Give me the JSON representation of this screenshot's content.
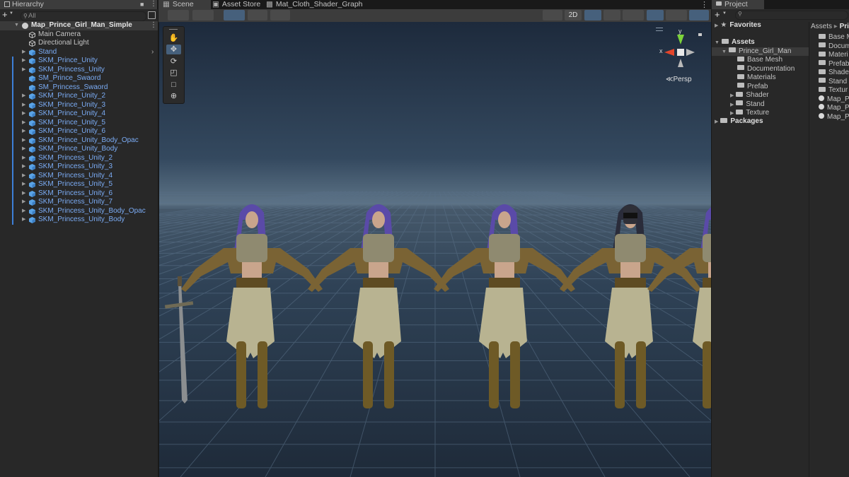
{
  "hierarchy": {
    "tab": "Hierarchy",
    "add": "+",
    "search_placeholder": "All",
    "scene_name": "Map_Prince_Girl_Man_Simple",
    "items": [
      {
        "label": "Main Camera",
        "type": "object"
      },
      {
        "label": "Directional Light",
        "type": "object"
      },
      {
        "label": "Stand",
        "type": "prefab"
      },
      {
        "label": "SKM_Prince_Unity",
        "type": "prefab"
      },
      {
        "label": "SKM_Princess_Unity",
        "type": "prefab"
      },
      {
        "label": "SM_Prince_Swaord",
        "type": "prefab"
      },
      {
        "label": "SM_Princess_Swaord",
        "type": "prefab"
      },
      {
        "label": "SKM_Prince_Unity_2",
        "type": "prefab"
      },
      {
        "label": "SKM_Prince_Unity_3",
        "type": "prefab"
      },
      {
        "label": "SKM_Prince_Unity_4",
        "type": "prefab"
      },
      {
        "label": "SKM_Prince_Unity_5",
        "type": "prefab"
      },
      {
        "label": "SKM_Prince_Unity_6",
        "type": "prefab"
      },
      {
        "label": "SKM_Prince_Unity_Body_Opac",
        "type": "prefab"
      },
      {
        "label": "SKM_Prince_Unity_Body",
        "type": "prefab"
      },
      {
        "label": "SKM_Princess_Unity_2",
        "type": "prefab"
      },
      {
        "label": "SKM_Princess_Unity_3",
        "type": "prefab"
      },
      {
        "label": "SKM_Princess_Unity_4",
        "type": "prefab"
      },
      {
        "label": "SKM_Princess_Unity_5",
        "type": "prefab"
      },
      {
        "label": "SKM_Princess_Unity_6",
        "type": "prefab"
      },
      {
        "label": "SKM_Princess_Unity_7",
        "type": "prefab"
      },
      {
        "label": "SKM_Princess_Unity_Body_Opac",
        "type": "prefab"
      },
      {
        "label": "SKM_Princess_Unity_Body",
        "type": "prefab"
      }
    ]
  },
  "scene": {
    "tabs": [
      "Scene",
      "Asset Store",
      "Mat_Cloth_Shader_Graph"
    ],
    "mode_2d": "2D",
    "persp_label": "Persp",
    "gizmo_y": "y",
    "gizmo_x": "x",
    "accent": "#46607c"
  },
  "project": {
    "tab": "Project",
    "add": "+",
    "favorites": "Favorites",
    "assets": "Assets",
    "packages": "Packages",
    "tree": [
      {
        "label": "Prince_Girl_Man",
        "depth": 1,
        "open": true
      },
      {
        "label": "Base Mesh",
        "depth": 2
      },
      {
        "label": "Documentation",
        "depth": 2
      },
      {
        "label": "Materials",
        "depth": 2
      },
      {
        "label": "Prefab",
        "depth": 2
      },
      {
        "label": "Shader",
        "depth": 2,
        "arrow": true
      },
      {
        "label": "Stand",
        "depth": 2,
        "arrow": true
      },
      {
        "label": "Texture",
        "depth": 2,
        "arrow": true
      }
    ],
    "breadcrumb": [
      "Assets",
      "Prince"
    ],
    "right_items": [
      {
        "label": "Base M",
        "kind": "folder"
      },
      {
        "label": "Docum",
        "kind": "folder"
      },
      {
        "label": "Materi",
        "kind": "folder"
      },
      {
        "label": "Prefab",
        "kind": "folder"
      },
      {
        "label": "Shader",
        "kind": "folder"
      },
      {
        "label": "Stand",
        "kind": "folder"
      },
      {
        "label": "Textur",
        "kind": "folder"
      },
      {
        "label": "Map_P",
        "kind": "scene"
      },
      {
        "label": "Map_P",
        "kind": "scene"
      },
      {
        "label": "Map_P",
        "kind": "scene"
      }
    ]
  }
}
